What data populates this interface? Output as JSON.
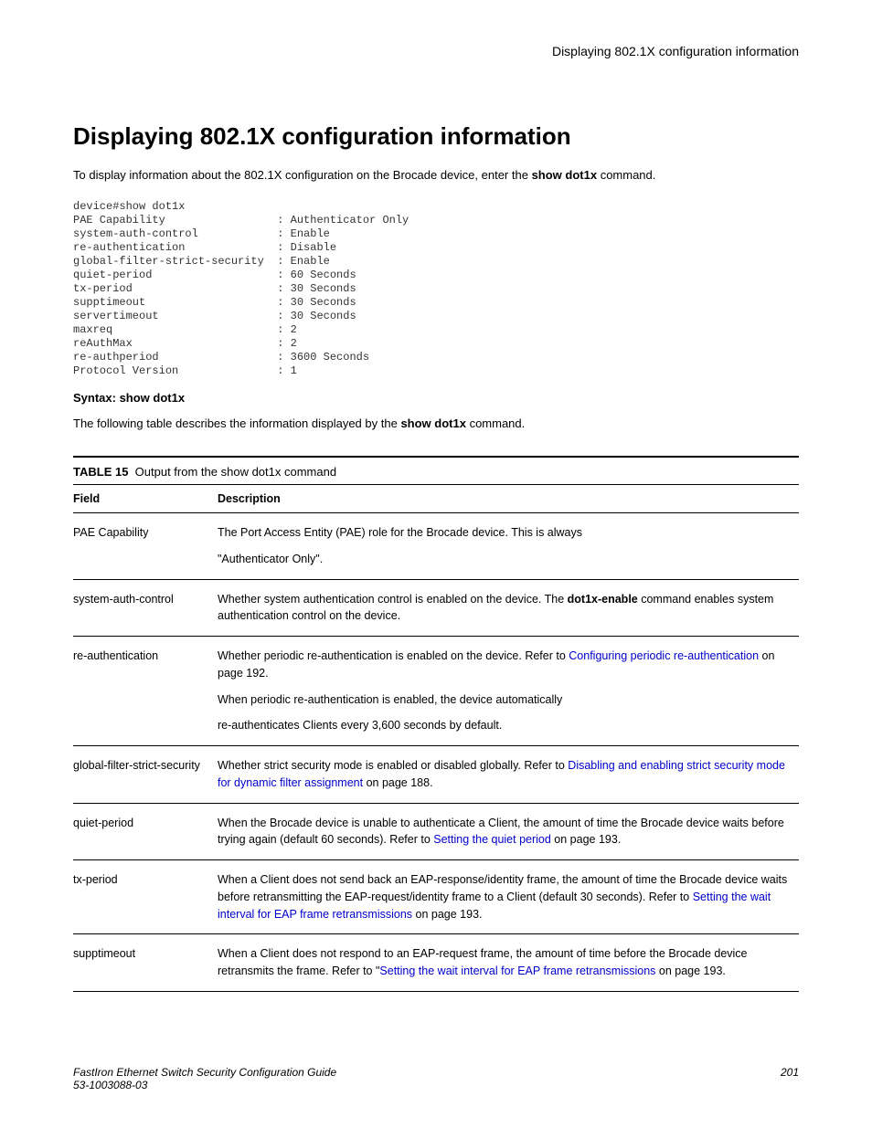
{
  "running_head": "Displaying 802.1X configuration information",
  "heading": "Displaying 802.1X configuration information",
  "intro_pre": "To display information about the 802.1X configuration on the Brocade device, enter the ",
  "intro_cmd": "show dot1x",
  "intro_post": " command.",
  "cli_output": "device#show dot1x\nPAE Capability                 : Authenticator Only\nsystem-auth-control            : Enable\nre-authentication              : Disable\nglobal-filter-strict-security  : Enable\nquiet-period                   : 60 Seconds\ntx-period                      : 30 Seconds\nsupptimeout                    : 30 Seconds\nservertimeout                  : 30 Seconds\nmaxreq                         : 2\nreAuthMax                      : 2\nre-authperiod                  : 3600 Seconds\nProtocol Version               : 1",
  "syntax_line": "Syntax: show dot1x",
  "table_intro_pre": "The following table describes the information displayed by the ",
  "table_intro_cmd": "show dot1x",
  "table_intro_post": " command.",
  "table_caption_label": "TABLE 15",
  "table_caption_text": "Output from the show dot1x command",
  "thead_field": "Field",
  "thead_desc": "Description",
  "rows": {
    "r0": {
      "field": "PAE Capability",
      "p1": "The Port Access Entity (PAE) role for the Brocade device. This is always",
      "p2": "\"Authenticator Only\"."
    },
    "r1": {
      "field": "system-auth-control",
      "pre": "Whether system authentication control is enabled on the device. The ",
      "bold": "dot1x-enable",
      "post": " command enables system authentication control on the device."
    },
    "r2": {
      "field": "re-authentication",
      "p1_pre": "Whether periodic re-authentication is enabled on the device. Refer to ",
      "p1_link": "Configuring periodic re-authentication",
      "p1_post": " on page 192.",
      "p2": "When periodic re-authentication is enabled, the device automatically",
      "p3": "re-authenticates Clients every 3,600 seconds by default."
    },
    "r3": {
      "field": "global-filter-strict-security",
      "pre": "Whether strict security mode is enabled or disabled globally. Refer to ",
      "link": "Disabling and enabling strict security mode for dynamic filter assignment",
      "post": " on page 188."
    },
    "r4": {
      "field": "quiet-period",
      "pre": "When the Brocade device is unable to authenticate a Client, the amount of time the Brocade device waits before trying again (default 60 seconds). Refer to ",
      "link": "Setting the quiet period",
      "post": " on page 193."
    },
    "r5": {
      "field": "tx-period",
      "pre": "When a Client does not send back an EAP-response/identity frame, the amount of time the Brocade device waits before retransmitting the EAP-request/identity frame to a Client (default 30 seconds). Refer to ",
      "link": "Setting the wait interval for EAP frame retransmissions",
      "post": " on page 193."
    },
    "r6": {
      "field": "supptimeout",
      "pre": "When a Client does not respond to an EAP-request frame, the amount of time before the Brocade device retransmits the frame. Refer to \"",
      "link": "Setting the wait interval for EAP frame retransmissions",
      "post": " on page 193."
    }
  },
  "footer_left_1": "FastIron Ethernet Switch Security Configuration Guide",
  "footer_left_2": "53-1003088-03",
  "footer_right": "201"
}
